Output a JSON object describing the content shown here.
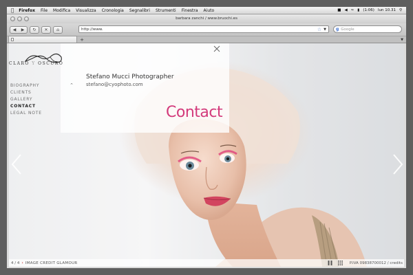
{
  "menubar": {
    "items": [
      "Firefox",
      "File",
      "Modifica",
      "Visualizza",
      "Cronologia",
      "Segnalibri",
      "Strumenti",
      "Finestra",
      "Aiuto"
    ],
    "battery": "(1:06)",
    "clock": "lun 10.31"
  },
  "window": {
    "title": "barbara zanchi / www.bruochi.es"
  },
  "toolbar": {
    "url": "http://www.",
    "search_placeholder": "Google"
  },
  "tab": {
    "add_label": "+"
  },
  "site": {
    "logo": {
      "word1": "CLARO",
      "word2": "Y",
      "word3": "OSCURO"
    },
    "nav": [
      {
        "label": "BIOGRAPHY",
        "active": false
      },
      {
        "label": "CLIENTS",
        "active": false
      },
      {
        "label": "GALLERY",
        "active": false
      },
      {
        "label": "CONTACT",
        "active": true
      },
      {
        "label": "LEGAL NOTE",
        "active": false
      }
    ],
    "contact": {
      "name": "Stefano Mucci Photographer",
      "email": "stefano@cyophoto.com",
      "title": "Contact"
    },
    "footer": {
      "counter": "4 / 4",
      "separator": "›",
      "credit": "IMAGE CREDIT GLAMOUR",
      "piva": "P.IVA 09838700012 / credits"
    }
  },
  "colors": {
    "accent": "#d33a7b",
    "nav_text": "#6d6d6d",
    "nav_active": "#222222"
  }
}
